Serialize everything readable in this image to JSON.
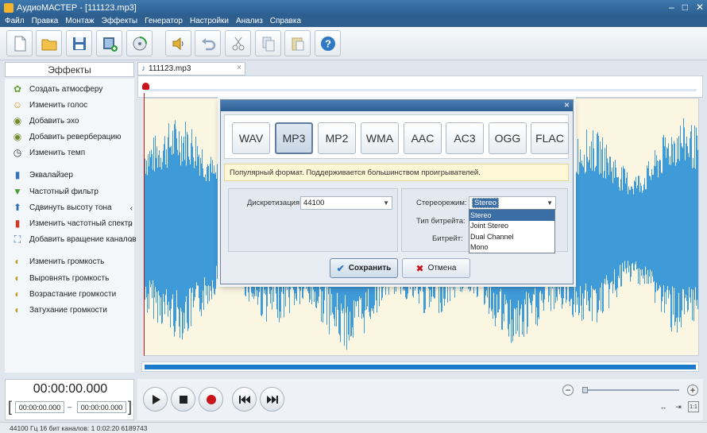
{
  "window": {
    "title": "АудиоМАСТЕР - [111123.mp3]"
  },
  "menu": [
    "Файл",
    "Правка",
    "Монтаж",
    "Эффекты",
    "Генератор",
    "Настройки",
    "Анализ",
    "Справка"
  ],
  "effects_panel": {
    "header": "Эффекты",
    "items": [
      {
        "label": "Создать атмосферу",
        "icon": "atmosphere-icon"
      },
      {
        "label": "Изменить голос",
        "icon": "voice-icon"
      },
      {
        "label": "Добавить эхо",
        "icon": "echo-icon"
      },
      {
        "label": "Добавить реверберацию",
        "icon": "reverb-icon"
      },
      {
        "label": "Изменить темп",
        "icon": "tempo-icon"
      },
      {
        "label": "Эквалайзер",
        "icon": "equalizer-icon"
      },
      {
        "label": "Частотный фильтр",
        "icon": "filter-icon"
      },
      {
        "label": "Сдвинуть высоту тона",
        "icon": "pitch-icon"
      },
      {
        "label": "Изменить частотный спектр",
        "icon": "spectrum-icon"
      },
      {
        "label": "Добавить вращение каналов",
        "icon": "rotation-icon"
      },
      {
        "label": "Изменить громкость",
        "icon": "volume-icon"
      },
      {
        "label": "Выровнять громкость",
        "icon": "normalize-icon"
      },
      {
        "label": "Возрастание громкости",
        "icon": "fade-in-icon"
      },
      {
        "label": "Затухание громкости",
        "icon": "fade-out-icon"
      }
    ]
  },
  "file_tab": {
    "name": "111123.mp3",
    "close": "×"
  },
  "dialog": {
    "close": "×",
    "formats": [
      "WAV",
      "MP3",
      "MP2",
      "WMA",
      "AAC",
      "AC3",
      "OGG",
      "FLAC"
    ],
    "selected_format": "MP3",
    "info": "Популярный формат. Поддерживается большинством проигрывателей.",
    "sample_rate_label": "Дискретизация:",
    "sample_rate_value": "44100",
    "stereo_label": "Стереорежим:",
    "stereo_value": "Stereo",
    "bitrate_type_label": "Тип битрейта:",
    "bitrate_label": "Битрейт:",
    "stereo_options": [
      "Stereo",
      "Joint Stereo",
      "Dual Channel",
      "Mono"
    ],
    "save_label": "Сохранить",
    "cancel_label": "Отмена"
  },
  "time": {
    "current": "00:00:00.000",
    "start": "00:00:00.000",
    "end": "00:00:00.000",
    "left_bracket": "[",
    "dash": "–",
    "right_bracket": "]"
  },
  "zoom": {
    "minus": "−",
    "plus": "+",
    "level": 0.02
  },
  "status": "44100 Гц  16 бит  каналов: 1    0:02:20 6189743",
  "colors": {
    "wave": "#3f9ad8",
    "accent": "#1d79c9",
    "playhead": "#c8141a",
    "title_bar": "#2c5f92"
  }
}
